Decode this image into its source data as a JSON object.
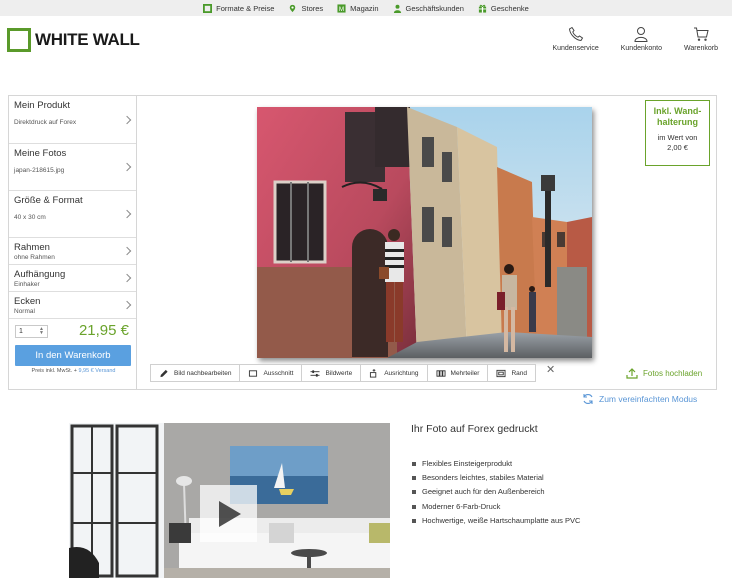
{
  "topbar": {
    "items": [
      {
        "label": "Formate & Preise",
        "icon": "frame-icon"
      },
      {
        "label": "Stores",
        "icon": "map-pin-icon"
      },
      {
        "label": "Magazin",
        "icon": "magazine-icon"
      },
      {
        "label": "Geschäftskunden",
        "icon": "business-user-icon"
      },
      {
        "label": "Geschenke",
        "icon": "gift-icon"
      }
    ]
  },
  "brand": {
    "name": "WHITE WALL",
    "color": "#5a9a2a"
  },
  "header_nav": [
    {
      "label": "Kundenservice",
      "icon": "phone-icon"
    },
    {
      "label": "Kundenkonto",
      "icon": "user-icon"
    },
    {
      "label": "Warenkorb",
      "icon": "cart-icon"
    }
  ],
  "config": {
    "product": {
      "title": "Mein Produkt",
      "value": "Direktdruck auf Forex"
    },
    "photos": {
      "title": "Meine Fotos",
      "value": "japan-218615.jpg"
    },
    "size": {
      "title": "Größe & Format",
      "value": "40 x 30 cm"
    },
    "frame": {
      "title": "Rahmen",
      "value": "ohne Rahmen"
    },
    "hanging": {
      "title": "Aufhängung",
      "value": "Einhaker"
    },
    "corners": {
      "title": "Ecken",
      "value": "Normal"
    },
    "quantity": "1",
    "price": "21,95 €",
    "add_to_cart": "In den Warenkorb",
    "price_note": "Preis inkl. MwSt. +",
    "shipping": "9,95 € Versand"
  },
  "promo": {
    "title_line1": "Inkl. Wand-",
    "title_line2": "halterung",
    "value_line1": "im Wert von",
    "value_line2": "2,00 €"
  },
  "tools": [
    {
      "label": "Bild nachbearbeiten",
      "icon": "pencil-icon"
    },
    {
      "label": "Ausschnitt",
      "icon": "crop-icon"
    },
    {
      "label": "Bildwerte",
      "icon": "sliders-icon"
    },
    {
      "label": "Ausrichtung",
      "icon": "align-icon"
    },
    {
      "label": "Mehrteiler",
      "icon": "multipanel-icon"
    },
    {
      "label": "Rand",
      "icon": "border-icon"
    }
  ],
  "upload": "Fotos hochladen",
  "simple_mode": "Zum vereinfachten Modus",
  "info": {
    "title": "Ihr Foto auf Forex gedruckt",
    "bullets": [
      "Flexibles Einsteigerprodukt",
      "Besonders leichtes, stabiles Material",
      "Geeignet auch für den Außenbereich",
      "Moderner 6-Farb-Druck",
      "Hochwertige, weiße Hartschaumplatte aus PVC"
    ]
  },
  "colors": {
    "accent_green": "#6aa32b",
    "button_blue": "#5aa0e0",
    "link_blue": "#5a96d6"
  }
}
